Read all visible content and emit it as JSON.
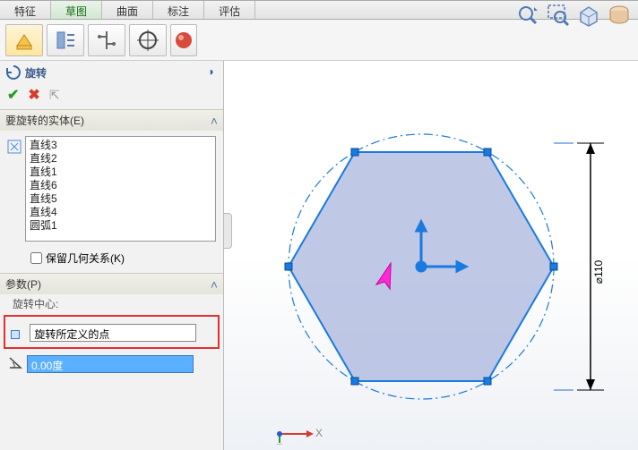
{
  "tabs": {
    "t0": "特征",
    "t1": "草图",
    "t2": "曲面",
    "t3": "标注",
    "t4": "评估"
  },
  "feature": {
    "title": "旋转"
  },
  "group1": {
    "title": "要旋转的实体(E)"
  },
  "entities": {
    "e0": "直线3",
    "e1": "直线2",
    "e2": "直线1",
    "e3": "直线6",
    "e4": "直线5",
    "e5": "直线4",
    "e6": "圆弧1"
  },
  "keep": {
    "label": "保留几何关系(K)"
  },
  "params": {
    "title": "参数(P)",
    "center": "旋转中心:"
  },
  "centerval": "旋转所定义的点",
  "angle": "0.00度",
  "dimlabel": "⌀110",
  "axis": {
    "x": "X",
    "z": "Z"
  }
}
